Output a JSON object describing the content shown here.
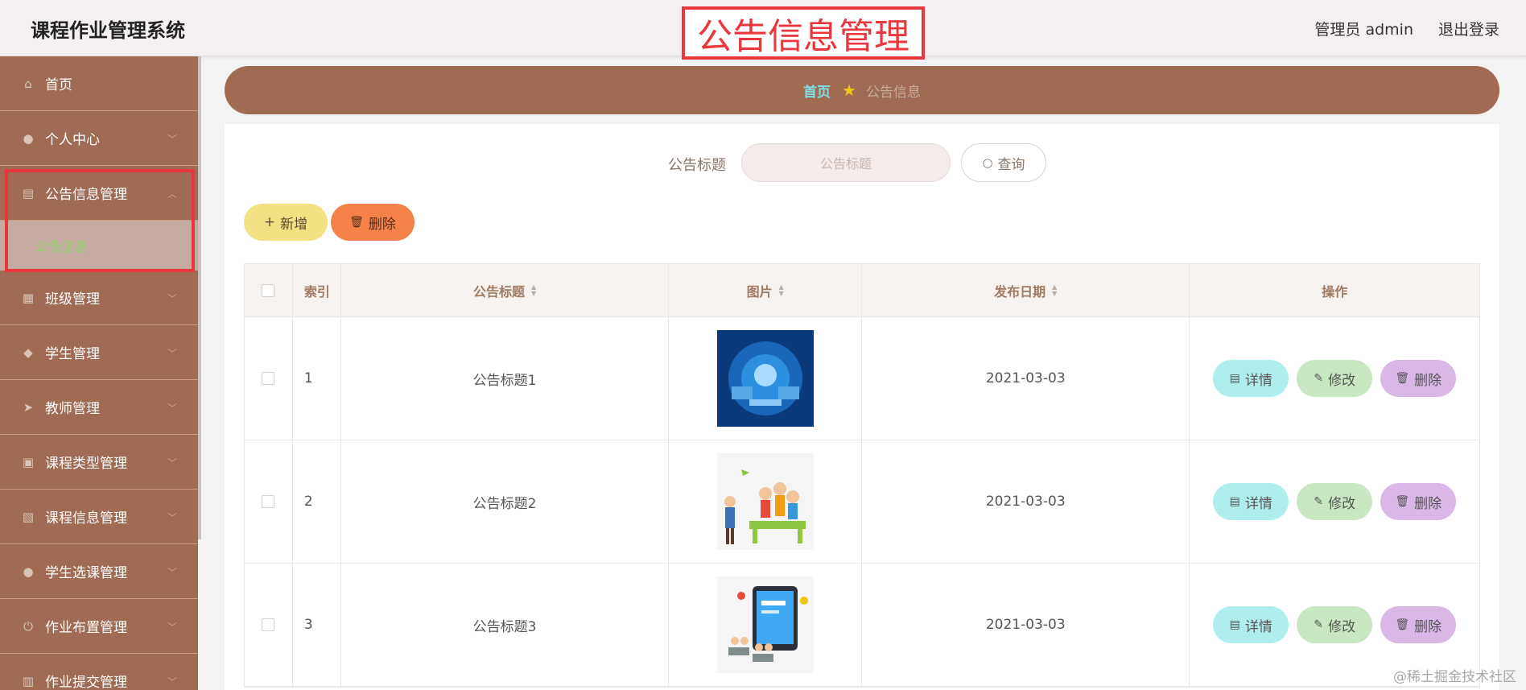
{
  "header": {
    "app_title": "课程作业管理系统",
    "page_heading": "公告信息管理",
    "user_info": "管理员 admin",
    "logout": "退出登录"
  },
  "sidebar": {
    "items": [
      {
        "label": "首页",
        "icon": "home-icon"
      },
      {
        "label": "个人中心",
        "icon": "user-icon"
      },
      {
        "label": "公告信息管理",
        "icon": "clipboard-icon"
      },
      {
        "label": "班级管理",
        "icon": "grid-icon"
      },
      {
        "label": "学生管理",
        "icon": "people-icon"
      },
      {
        "label": "教师管理",
        "icon": "send-icon"
      },
      {
        "label": "课程类型管理",
        "icon": "briefcase-icon"
      },
      {
        "label": "课程信息管理",
        "icon": "document-icon"
      },
      {
        "label": "学生选课管理",
        "icon": "user-icon"
      },
      {
        "label": "作业布置管理",
        "icon": "power-icon"
      },
      {
        "label": "作业提交管理",
        "icon": "book-icon"
      }
    ],
    "submenu_label": "公告信息"
  },
  "breadcrumb": {
    "home": "首页",
    "current": "公告信息"
  },
  "search": {
    "label": "公告标题",
    "placeholder": "公告标题",
    "button": "查询"
  },
  "actions": {
    "add": "新增",
    "delete": "删除"
  },
  "table": {
    "headers": {
      "index": "索引",
      "title": "公告标题",
      "image": "图片",
      "date": "发布日期",
      "ops": "操作"
    },
    "rows": [
      {
        "index": "1",
        "title": "公告标题1",
        "date": "2021-03-03"
      },
      {
        "index": "2",
        "title": "公告标题2",
        "date": "2021-03-03"
      },
      {
        "index": "3",
        "title": "公告标题3",
        "date": "2021-03-03"
      }
    ],
    "row_buttons": {
      "detail": "详情",
      "edit": "修改",
      "delete": "删除"
    }
  },
  "watermark": "@稀土掘金技术社区",
  "colors": {
    "sidebar": "#a06b52",
    "highlight": "#e8383d",
    "detail_btn": "#aeeeed",
    "edit_btn": "#c9e7c2",
    "delete_btn": "#d9b7e6"
  }
}
